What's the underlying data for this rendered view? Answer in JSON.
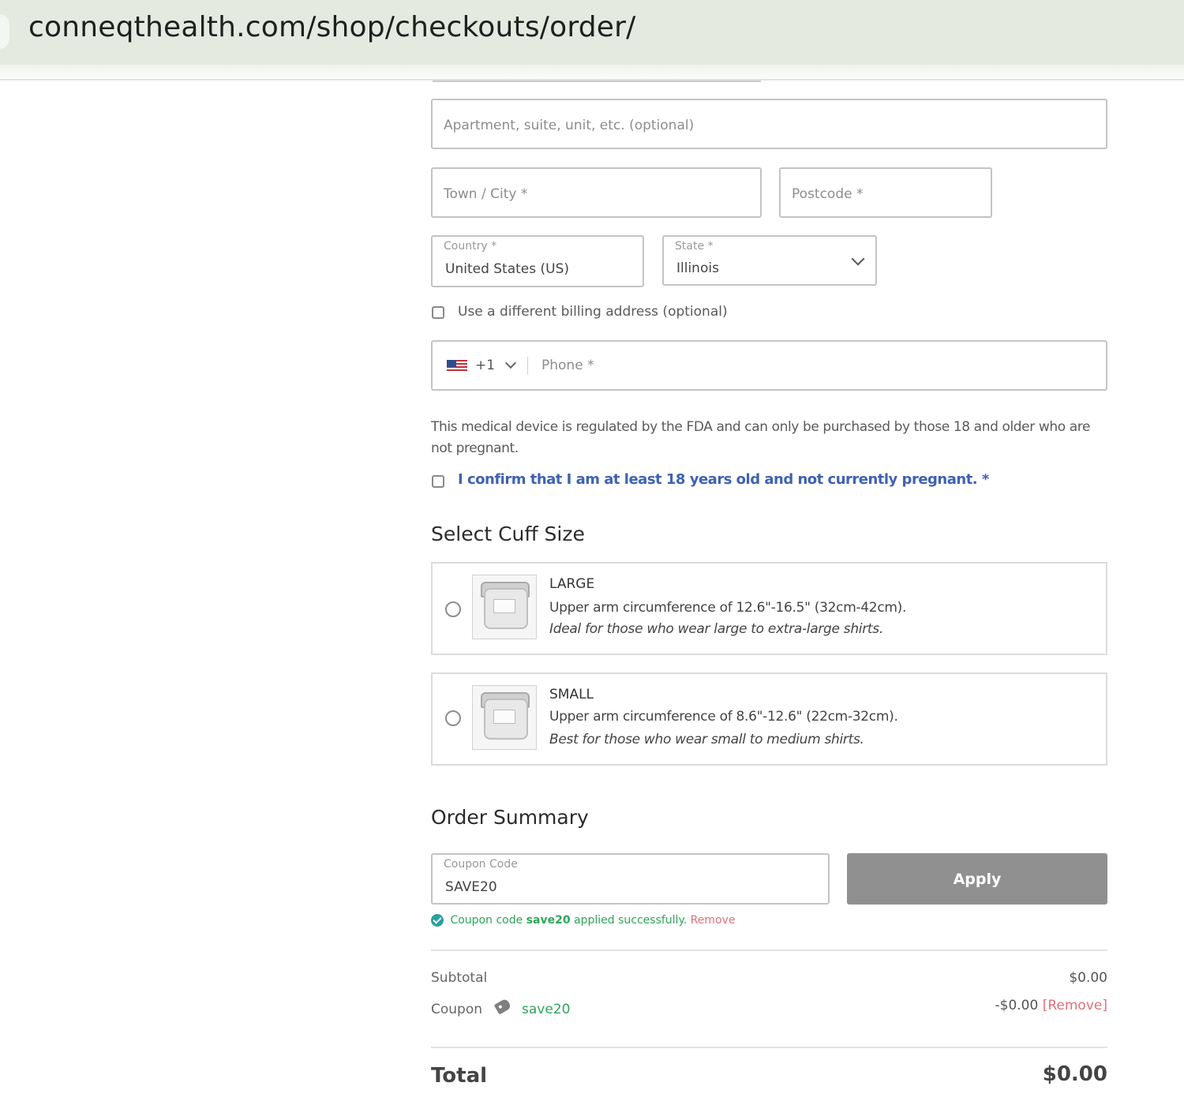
{
  "browser": {
    "url": "conneqthealth.com/shop/checkouts/order/"
  },
  "address": {
    "apartment_placeholder": "Apartment, suite, unit, etc. (optional)",
    "city_placeholder": "Town / City *",
    "postcode_placeholder": "Postcode *",
    "country_label": "Country *",
    "country_value": "United States (US)",
    "state_label": "State *",
    "state_value": "Illinois",
    "billing_checkbox_label": "Use a different billing address (optional)",
    "billing_checked": false
  },
  "phone": {
    "flag_icon": "us-flag-icon",
    "country_code": "+1",
    "placeholder": "Phone *"
  },
  "age_notice": {
    "text": "This medical device is regulated by the FDA and can only be purchased by those 18 and older who are not pregnant.",
    "confirm_label": "I confirm that I am at least 18 years old and not currently pregnant. *",
    "confirm_checked": false
  },
  "cuff": {
    "heading": "Select Cuff Size",
    "options": [
      {
        "title": "LARGE",
        "description": "Upper arm circumference of 12.6\"-16.5\" (32cm-42cm).",
        "note": "Ideal for those who wear large to extra-large shirts.",
        "selected": false
      },
      {
        "title": "SMALL",
        "description": "Upper arm circumference of 8.6\"-12.6\" (22cm-32cm).",
        "note": "Best for those who wear small to medium shirts.",
        "selected": false
      }
    ]
  },
  "order_summary": {
    "heading": "Order Summary",
    "coupon_label": "Coupon Code",
    "coupon_value": "SAVE20",
    "apply_label": "Apply",
    "success_prefix": "Coupon code",
    "success_code": "save20",
    "success_suffix": "applied successfully.",
    "success_remove": "Remove",
    "subtotal_label": "Subtotal",
    "subtotal_value": "$0.00",
    "coupon_row_label": "Coupon",
    "coupon_row_code": "save20",
    "coupon_row_value": "-$0.00",
    "coupon_row_remove": "[Remove]",
    "total_label": "Total",
    "total_value": "$0.00",
    "colors": {
      "success": "#2fa55b",
      "remove": "#e0707a",
      "link": "#3e62b3",
      "button": "#909090"
    }
  }
}
